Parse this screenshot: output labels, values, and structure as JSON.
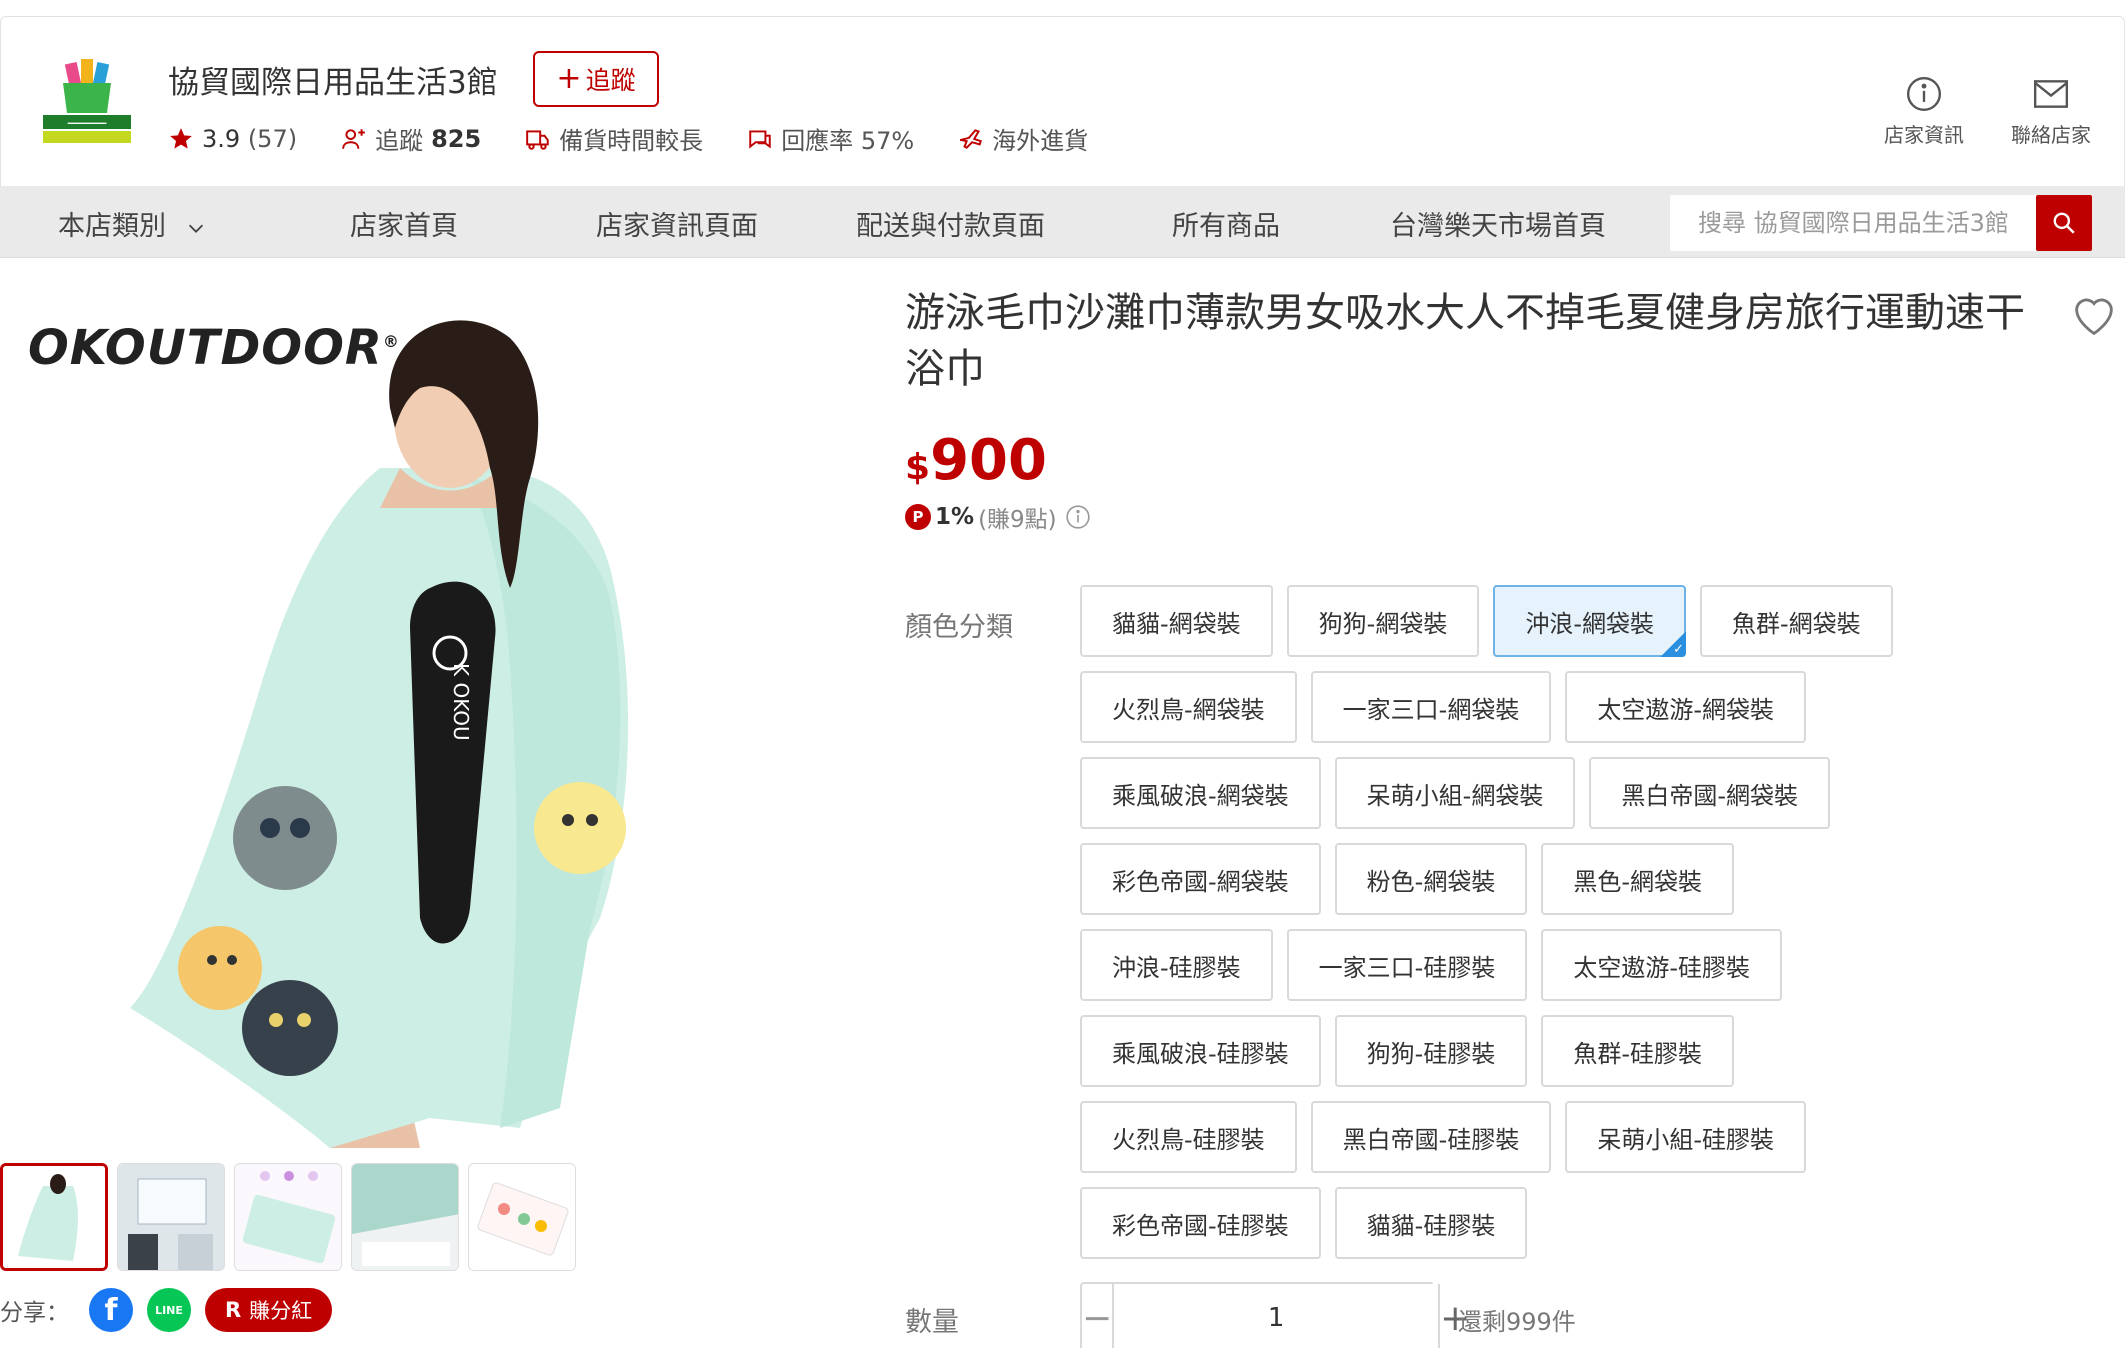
{
  "shop": {
    "name": "協貿國際日用品生活3館",
    "follow_label": "追蹤",
    "rating": "3.9",
    "review_count": "(57)",
    "followers_label": "追蹤",
    "followers_count": "825",
    "prep_time": "備貨時間較長",
    "response_rate": "回應率 57%",
    "overseas": "海外進貨",
    "store_info_label": "店家資訊",
    "contact_label": "聯絡店家"
  },
  "nav": {
    "items": [
      "本店類別",
      "店家首頁",
      "店家資訊頁面",
      "配送與付款頁面",
      "所有商品",
      "台灣樂天市場首頁"
    ],
    "search_placeholder": "搜尋 協貿國際日用品生活3館"
  },
  "product": {
    "brand": "OKOUTDOOR",
    "title": "游泳毛巾沙灘巾薄款男女吸水大人不掉毛夏健身房旅行運動速干浴巾",
    "currency": "$",
    "price": "900",
    "points_pct": "1%",
    "points_text": "(賺9點)",
    "option_label": "顏色分類",
    "options": [
      {
        "label": "貓貓-網袋裝",
        "selected": false
      },
      {
        "label": "狗狗-網袋裝",
        "selected": false
      },
      {
        "label": "沖浪-網袋裝",
        "selected": true
      },
      {
        "label": "魚群-網袋裝",
        "selected": false
      },
      {
        "label": "火烈鳥-網袋裝",
        "selected": false
      },
      {
        "label": "一家三口-網袋裝",
        "selected": false
      },
      {
        "label": "太空遨游-網袋裝",
        "selected": false
      },
      {
        "label": "乘風破浪-網袋裝",
        "selected": false
      },
      {
        "label": "呆萌小組-網袋裝",
        "selected": false
      },
      {
        "label": "黑白帝國-網袋裝",
        "selected": false
      },
      {
        "label": "彩色帝國-網袋裝",
        "selected": false
      },
      {
        "label": "粉色-網袋裝",
        "selected": false
      },
      {
        "label": "黑色-網袋裝",
        "selected": false
      },
      {
        "label": "沖浪-硅膠裝",
        "selected": false
      },
      {
        "label": "一家三口-硅膠裝",
        "selected": false
      },
      {
        "label": "太空遨游-硅膠裝",
        "selected": false
      },
      {
        "label": "乘風破浪-硅膠裝",
        "selected": false
      },
      {
        "label": "狗狗-硅膠裝",
        "selected": false
      },
      {
        "label": "魚群-硅膠裝",
        "selected": false
      },
      {
        "label": "火烈鳥-硅膠裝",
        "selected": false
      },
      {
        "label": "黑白帝國-硅膠裝",
        "selected": false
      },
      {
        "label": "呆萌小組-硅膠裝",
        "selected": false
      },
      {
        "label": "彩色帝國-硅膠裝",
        "selected": false
      },
      {
        "label": "貓貓-硅膠裝",
        "selected": false
      }
    ],
    "qty_label": "數量",
    "qty_value": "1",
    "stock_text": "還剩999件"
  },
  "share": {
    "label": "分享：",
    "earn_label": "賺分紅",
    "earn_icon": "R"
  },
  "colors": {
    "brand_red": "#bf0000",
    "selected_blue": "#2b8fdf"
  }
}
